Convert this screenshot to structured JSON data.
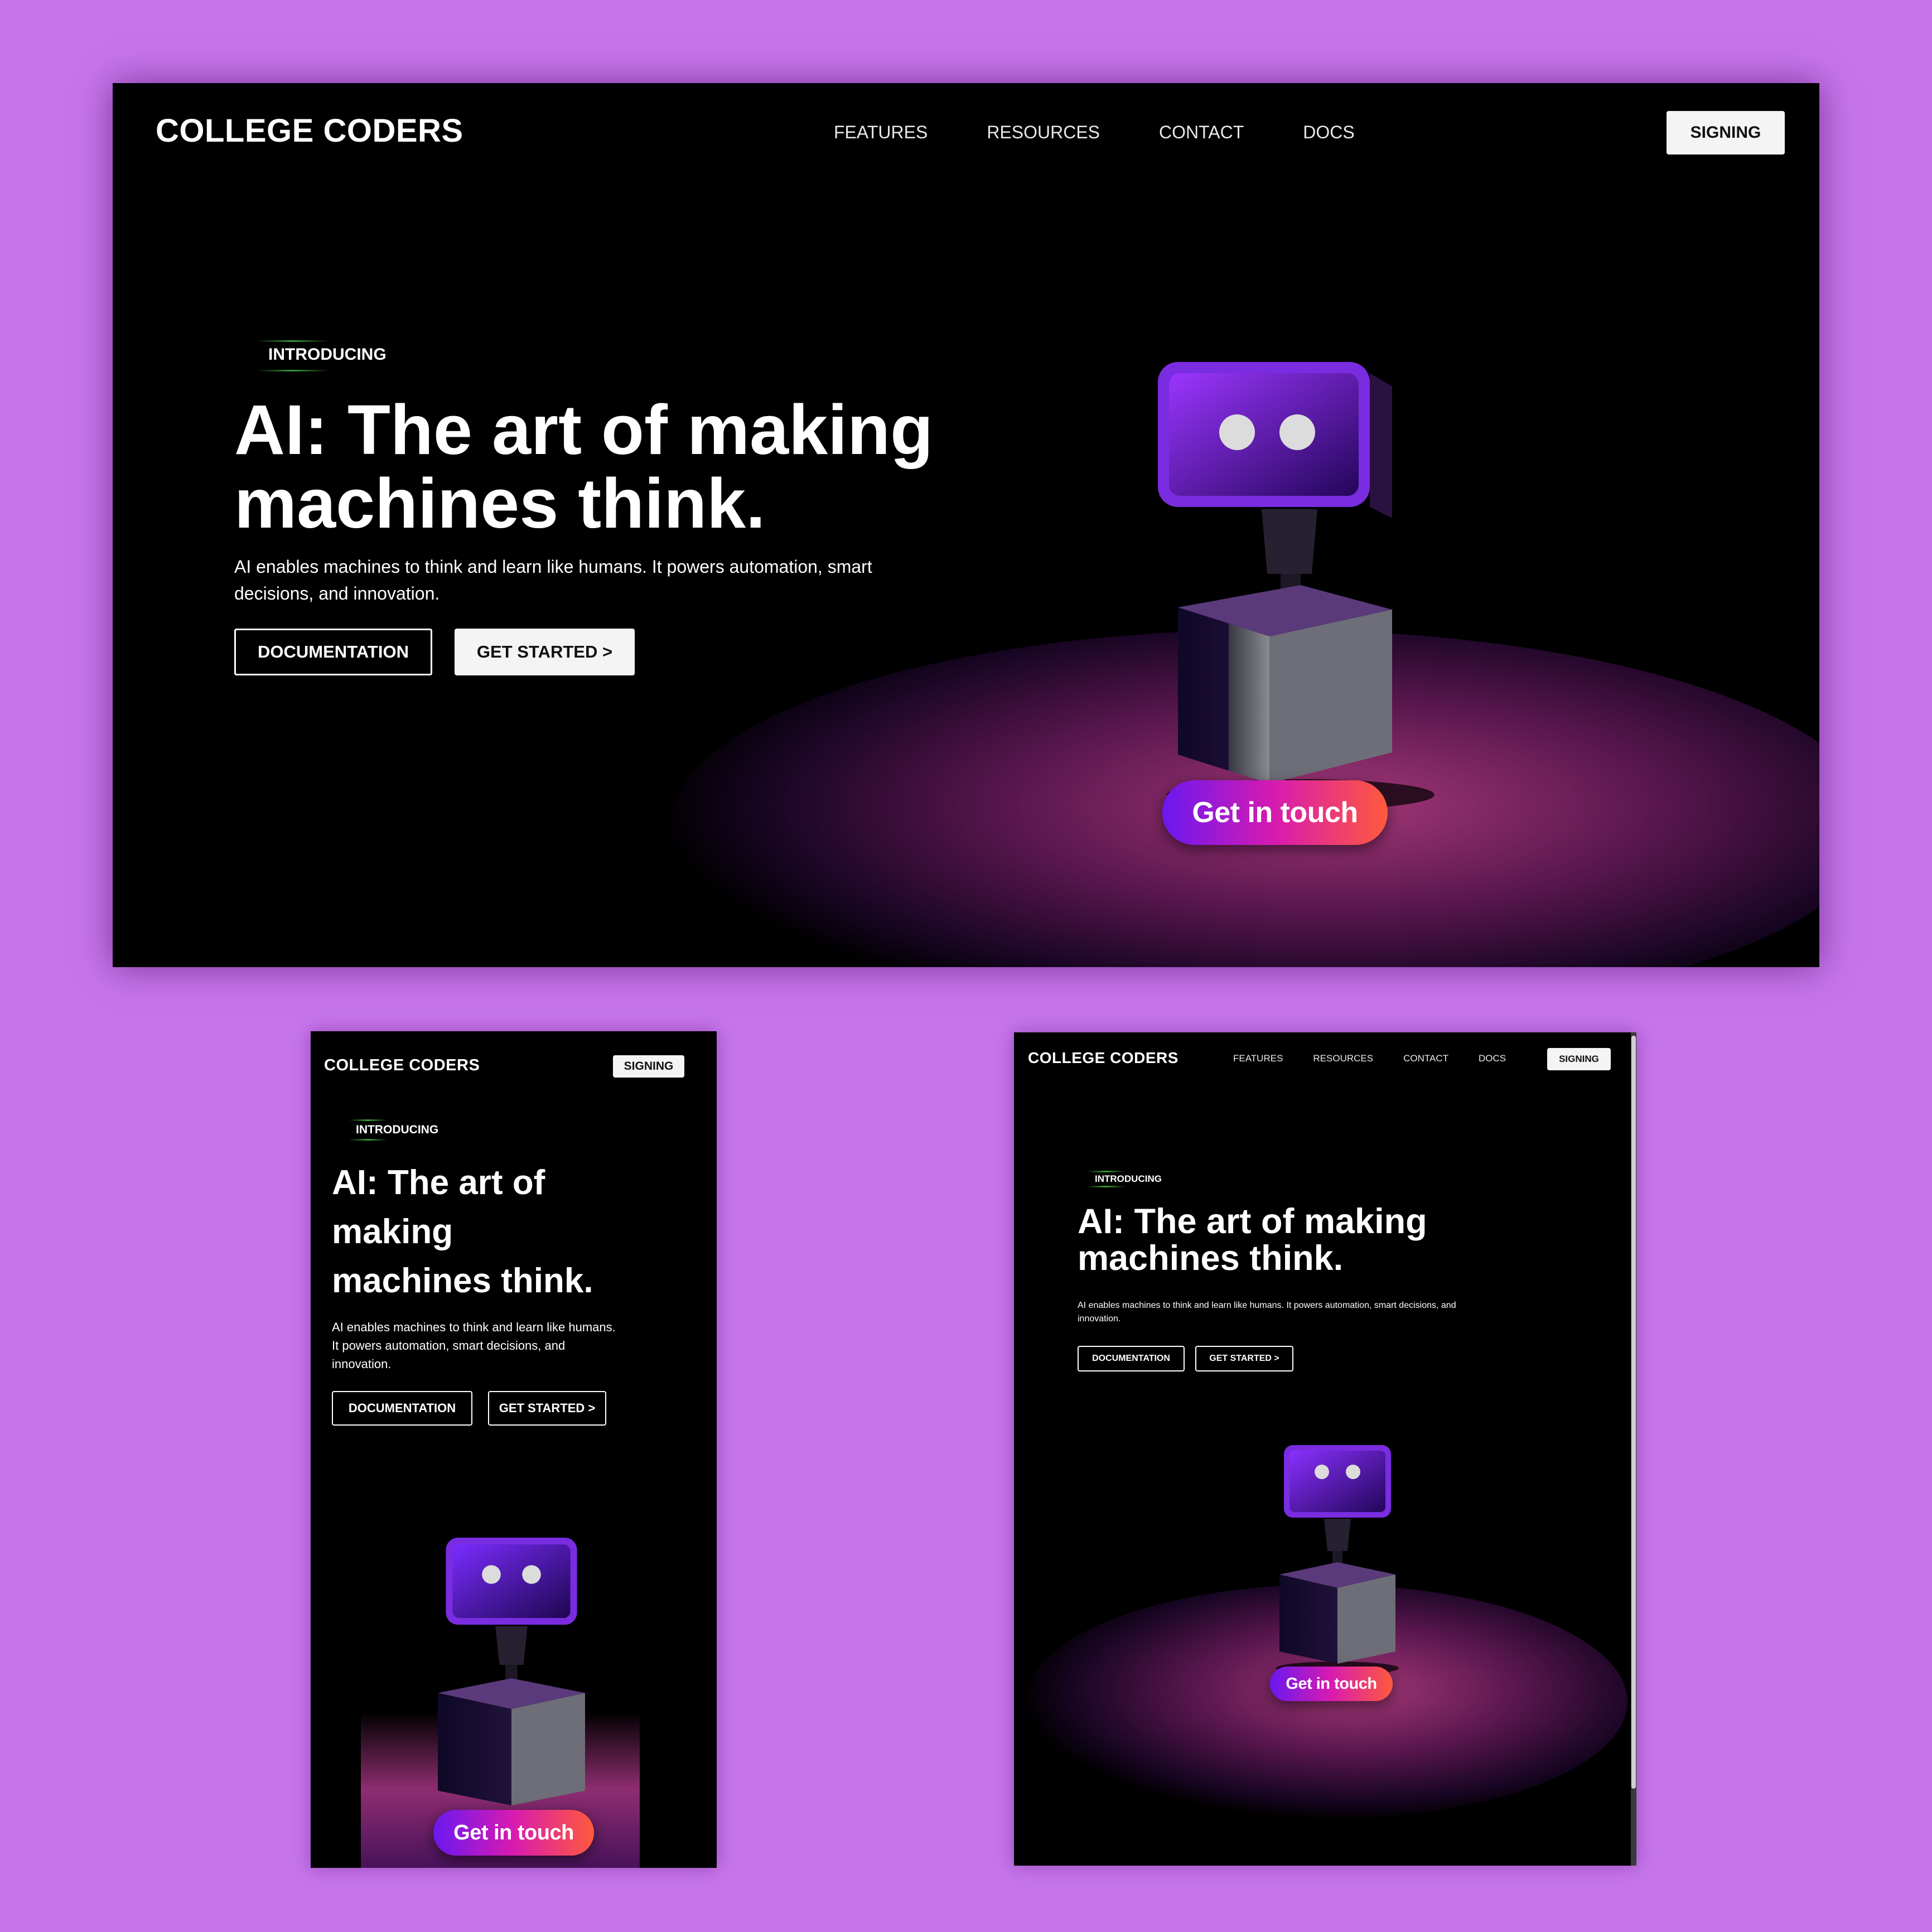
{
  "brand": "COLLEGE CODERS",
  "nav": [
    "FEATURES",
    "RESOURCES",
    "CONTACT",
    "DOCS"
  ],
  "signin_label": "SIGNING",
  "hero": {
    "eyebrow": "INTRODUCING",
    "headline_line1": "AI: The art of making",
    "headline_line2": "machines think.",
    "mobile_line1": "AI: The art of",
    "mobile_line2": "making",
    "mobile_line3": "machines think.",
    "description": "AI enables machines to think and learn like humans. It powers automation, smart decisions, and innovation.",
    "primary_button": "DOCUMENTATION",
    "secondary_button": "GET STARTED >",
    "cta": "Get in touch"
  },
  "colors": {
    "background": "#c674ea",
    "page": "#000000",
    "accent_start": "#6a18f0",
    "accent_mid": "#d81bb0",
    "accent_end": "#ff5a3c"
  },
  "icons": [
    "robot-illustration"
  ]
}
